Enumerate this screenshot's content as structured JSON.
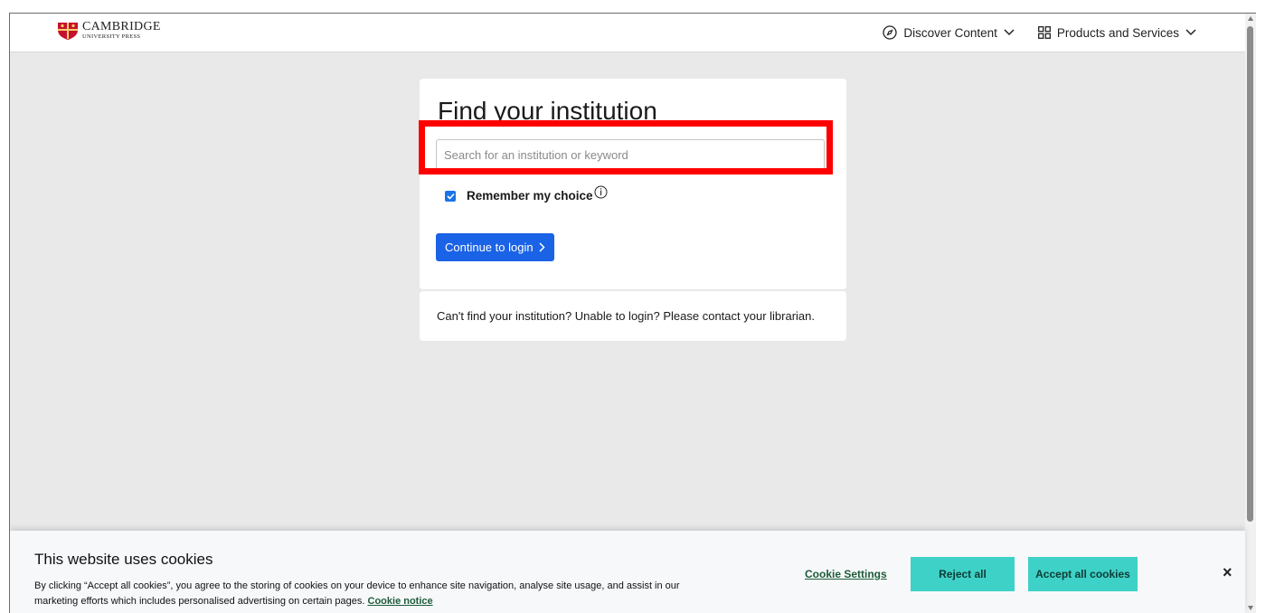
{
  "header": {
    "logo": {
      "main": "CAMBRIDGE",
      "sub": "UNIVERSITY PRESS"
    },
    "nav": [
      {
        "label": "Discover Content",
        "icon": "compass-icon"
      },
      {
        "label": "Products and Services",
        "icon": "grid-icon"
      }
    ]
  },
  "card": {
    "title": "Find your institution",
    "search_placeholder": "Search for an institution or keyword",
    "search_value": "",
    "remember_label": "Remember my choice",
    "remember_checked": true,
    "continue_label": "Continue to login"
  },
  "help": {
    "text": "Can't find your institution? Unable to login? Please contact your librarian."
  },
  "cookie": {
    "title": "This website uses cookies",
    "text": "By clicking “Accept all cookies”, you agree to the storing of cookies on your device to enhance site navigation, analyse site usage, and assist in our marketing efforts which includes personalised advertising on certain pages.",
    "notice_link": "Cookie notice",
    "settings_label": "Cookie Settings",
    "reject_label": "Reject all",
    "accept_label": "Accept all cookies",
    "close_label": "×"
  },
  "colors": {
    "primary_button": "#1a62e6",
    "cookie_button": "#3ed1c8",
    "highlight": "#ff0000",
    "page_background": "#e9e9e9"
  }
}
